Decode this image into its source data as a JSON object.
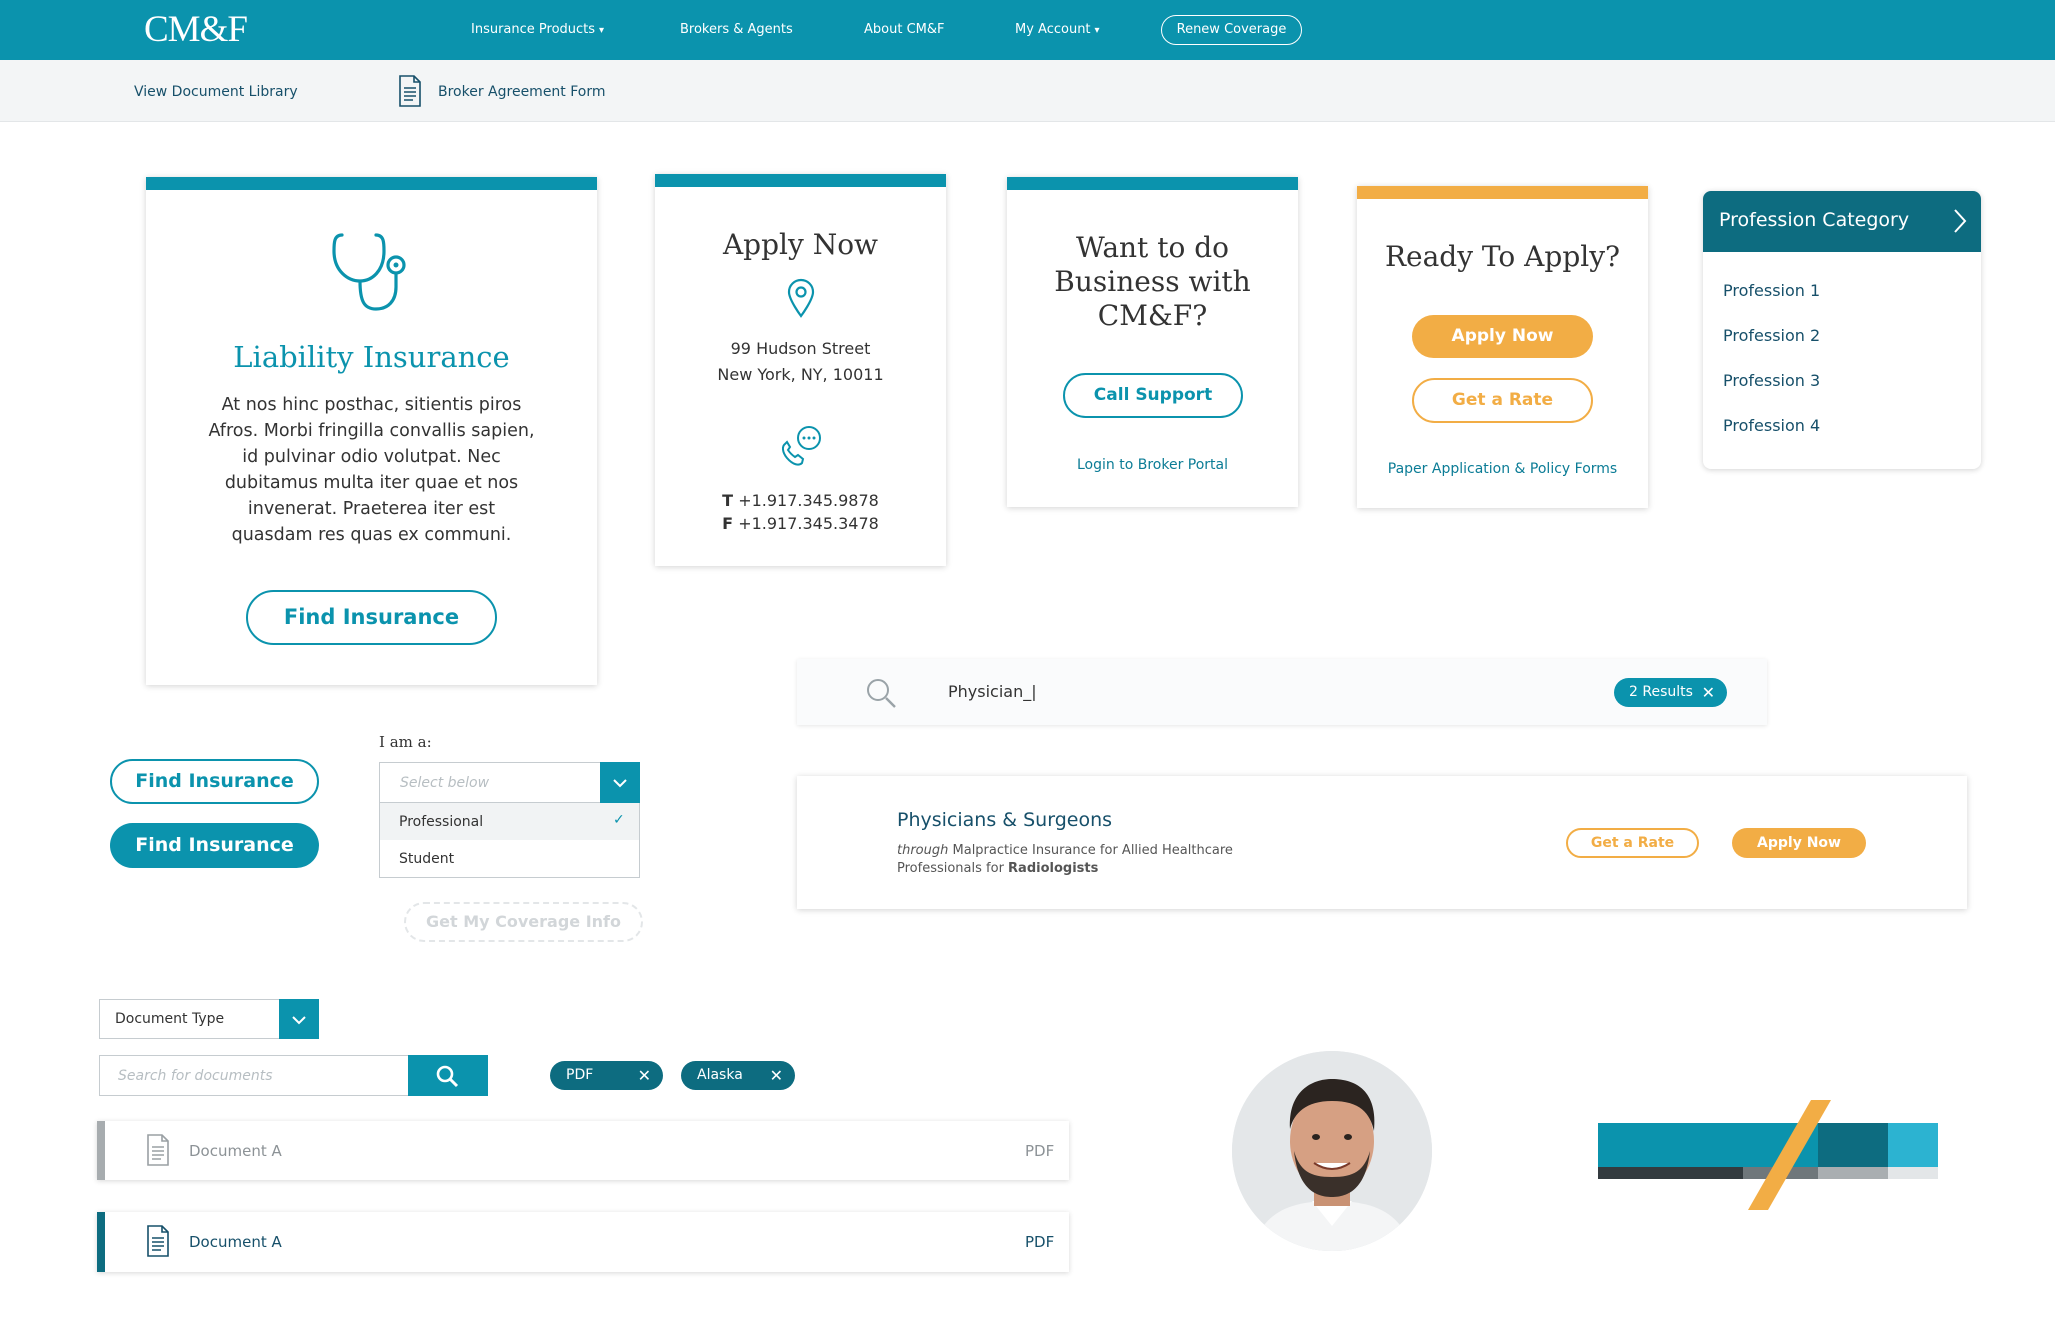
{
  "brand": {
    "logo": "CM&F",
    "primary": "#0b93ad",
    "dark": "#0d6c80",
    "accent": "#f2ad45"
  },
  "nav": {
    "items": [
      {
        "label": "Insurance Products",
        "caret": "▾"
      },
      {
        "label": "Brokers & Agents"
      },
      {
        "label": "About CM&F"
      },
      {
        "label": "My Account",
        "caret": "▾"
      }
    ],
    "cta": "Renew Coverage"
  },
  "subnav": {
    "library": "View Document Library",
    "form": "Broker Agreement Form",
    "form_icon": "document-icon"
  },
  "liability_card": {
    "icon": "stethoscope-icon",
    "title": "Liability Insurance",
    "body": "At nos hinc posthac, sitientis piros Afros. Morbi fringilla convallis sapien, id pulvinar odio volutpat. Nec dubitamus multa iter quae et nos invenerat. Praeterea iter est quasdam res quas ex communi.",
    "button": "Find Insurance"
  },
  "apply_card": {
    "title": "Apply Now",
    "icon_location": "map-pin-icon",
    "address_line1": "99 Hudson Street",
    "address_line2": "New York, NY, 10011",
    "icon_phone": "phone-chat-icon",
    "tel_label": "T",
    "tel": "+1.917.345.9878",
    "fax_label": "F",
    "fax": "+1.917.345.3478"
  },
  "business_card": {
    "title": "Want to do Business with CM&F?",
    "button": "Call Support",
    "link": "Login to Broker Portal"
  },
  "ready_card": {
    "title": "Ready To Apply?",
    "primary": "Apply Now",
    "secondary": "Get a Rate",
    "link": "Paper Application & Policy Forms"
  },
  "profession": {
    "header": "Profession Category",
    "items": [
      "Profession 1",
      "Profession 2",
      "Profession 3",
      "Profession 4"
    ]
  },
  "search": {
    "value": "Physician_|",
    "results": "2 Results"
  },
  "result": {
    "title": "Physicians & Surgeons",
    "through": "through",
    "desc": " Malpractice Insurance for Allied Healthcare",
    "desc2": "Professionals for ",
    "bold": "Radiologists",
    "rate": "Get a Rate",
    "apply": "Apply Now"
  },
  "buttons": {
    "outline": "Find Insurance",
    "solid": "Find Insurance"
  },
  "iam": {
    "label": "I am a:",
    "placeholder": "Select below",
    "options": [
      "Professional",
      "Student"
    ],
    "selected_mark": "✓",
    "submit": "Get My Coverage Info"
  },
  "documents": {
    "type_select": "Document Type",
    "search_placeholder": "Search for documents",
    "filters": [
      "PDF",
      "Alaska"
    ],
    "rows": [
      {
        "name": "Document A",
        "type": "PDF"
      },
      {
        "name": "Document A",
        "type": "PDF"
      }
    ]
  }
}
